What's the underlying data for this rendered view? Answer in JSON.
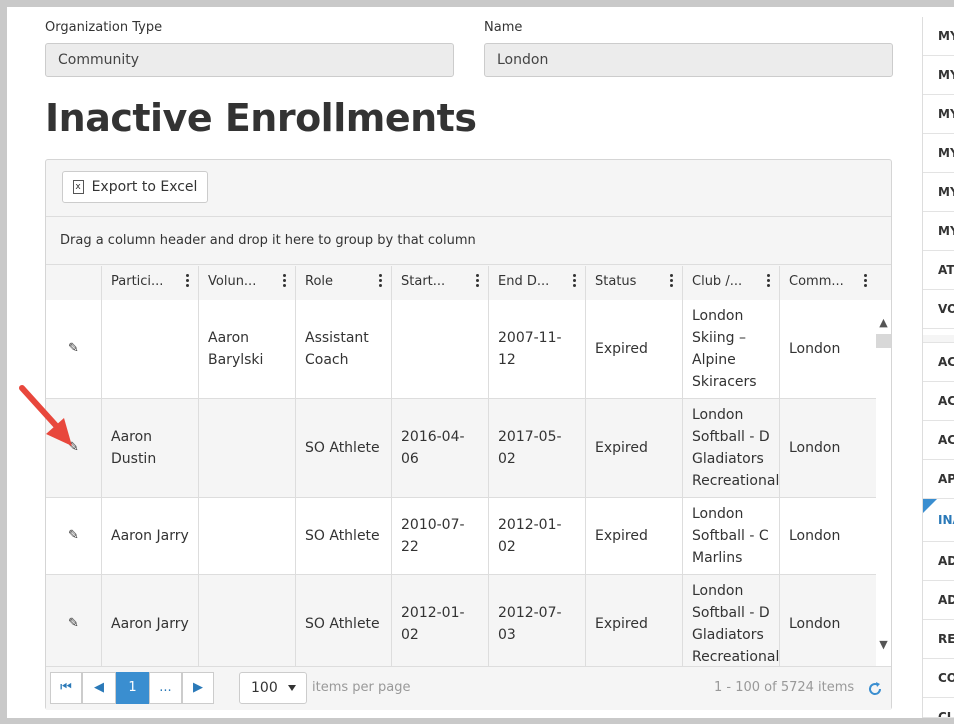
{
  "filters": {
    "org_type_label": "Organization Type",
    "org_type_value": "Community",
    "name_label": "Name",
    "name_value": "London"
  },
  "page_title": "Inactive Enrollments",
  "toolbar": {
    "export_label": "Export to Excel",
    "export_icon": "excel-file-icon",
    "export_icon_glyph": "x"
  },
  "grouping_hint": "Drag a column header and drop it here to group by that column",
  "columns": [
    {
      "label": ""
    },
    {
      "label": "Partici..."
    },
    {
      "label": "Volun..."
    },
    {
      "label": "Role"
    },
    {
      "label": "Start..."
    },
    {
      "label": "End D..."
    },
    {
      "label": "Status"
    },
    {
      "label": "Club /..."
    },
    {
      "label": "Comm..."
    }
  ],
  "rows": [
    {
      "participant": "",
      "volunteer": "Aaron Barylski",
      "role": "Assistant Coach",
      "start": "",
      "end": "2007-11-12",
      "status": "Expired",
      "club": "London Skiing – Alpine Skiracers",
      "community": "London"
    },
    {
      "participant": "Aaron Dustin",
      "volunteer": "",
      "role": "SO Athlete",
      "start": "2016-04-06",
      "end": "2017-05-02",
      "status": "Expired",
      "club": "London Softball - D Gladiators Recreational",
      "community": "London"
    },
    {
      "participant": "Aaron Jarry",
      "volunteer": "",
      "role": "SO Athlete",
      "start": "2010-07-22",
      "end": "2012-01-02",
      "status": "Expired",
      "club": "London Softball - C Marlins",
      "community": "London"
    },
    {
      "participant": "Aaron Jarry",
      "volunteer": "",
      "role": "SO Athlete",
      "start": "2012-01-02",
      "end": "2012-07-03",
      "status": "Expired",
      "club": "London Softball - D Gladiators Recreational",
      "community": "London"
    }
  ],
  "pager": {
    "first_glyph": "⏮",
    "prev_glyph": "◀",
    "current_page": "1",
    "more": "...",
    "next_glyph": "▶",
    "page_size": "100",
    "items_per_page": "items per page",
    "info": "1 - 100 of 5724 items"
  },
  "right_panel": {
    "items_a": [
      "MY",
      "MY",
      "MY",
      "MY",
      "MY",
      "MY",
      "AT",
      "VO"
    ],
    "items_b": [
      "AC",
      "AC",
      "AC",
      "AP"
    ],
    "active_item": "INA",
    "items_c": [
      "AD",
      "AD",
      "RE",
      "CO",
      "CL"
    ]
  },
  "colors": {
    "accent": "#3a8ed0",
    "annotation_arrow": "#e8473c"
  }
}
